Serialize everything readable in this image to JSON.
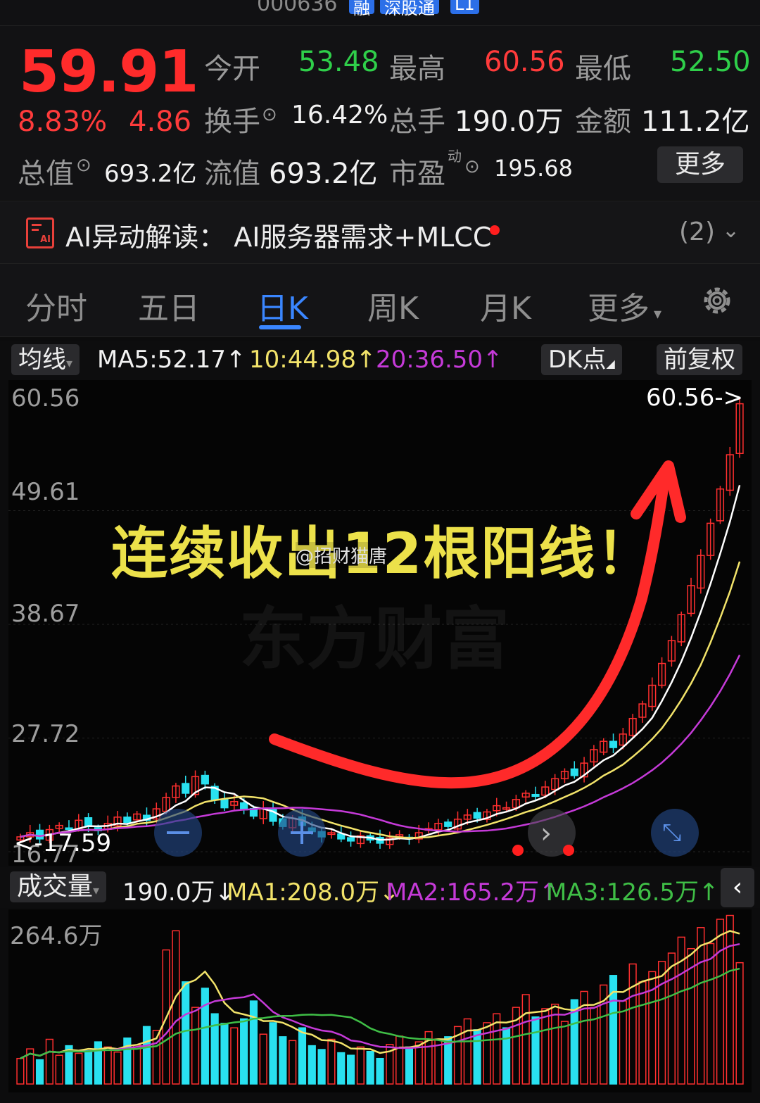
{
  "header": {
    "stock_code": "000636",
    "tags": [
      "融",
      "深股通",
      "L1"
    ]
  },
  "quote": {
    "price": "59.91",
    "change_pct": "8.83%",
    "change": "4.86",
    "open_label": "今开",
    "open": "53.48",
    "high_label": "最高",
    "high": "60.56",
    "low_label": "最低",
    "low": "52.50",
    "turnover_label": "换手",
    "turnover": "16.42%",
    "volume_label": "总手",
    "volume": "190.0万",
    "amount_label": "金额",
    "amount": "111.2亿",
    "mktcap_label": "总值",
    "mktcap": "693.2亿",
    "float_label": "流值",
    "float": "693.2亿",
    "pe_label": "市盈",
    "pe_sup": "动",
    "pe": "195.68",
    "more_label": "更多"
  },
  "ai_bar": {
    "text": "AI异动解读：  AI服务器需求+MLCC",
    "count": "(2)"
  },
  "tabs": [
    "分时",
    "五日",
    "日K",
    "周K",
    "月K",
    "更多"
  ],
  "active_tab": "日K",
  "ma_row": {
    "selector": "均线",
    "ma5": "MA5:52.17↑",
    "ma10": "10:44.98↑",
    "ma20": "20:36.50↑",
    "dk": "DK点",
    "fq": "前复权"
  },
  "chart_data": {
    "type": "candlestick",
    "y_ticks": [
      "60.56",
      "49.61",
      "38.67",
      "27.72",
      "16.77"
    ],
    "ylim": [
      16.77,
      60.56
    ],
    "high_marker": "60.56->",
    "low_marker": "<-17.59",
    "closes": [
      18.2,
      18.6,
      18.0,
      18.9,
      19.3,
      19.0,
      19.8,
      19.2,
      18.8,
      19.5,
      20.1,
      19.6,
      20.4,
      19.8,
      20.9,
      22.0,
      23.1,
      22.4,
      24.0,
      23.3,
      21.8,
      21.0,
      21.6,
      20.8,
      20.2,
      20.9,
      19.7,
      19.2,
      20.0,
      19.3,
      18.7,
      18.2,
      18.6,
      18.0,
      17.8,
      18.3,
      17.9,
      17.59,
      18.1,
      18.4,
      18.0,
      18.6,
      19.0,
      19.5,
      19.2,
      19.9,
      20.3,
      20.0,
      20.6,
      21.2,
      21.0,
      21.8,
      22.4,
      22.1,
      23.0,
      23.8,
      24.5,
      24.1,
      25.3,
      26.6,
      27.4,
      26.8,
      28.1,
      29.6,
      31.0,
      32.8,
      34.9,
      37.1,
      39.6,
      42.4,
      45.3,
      48.4,
      51.7,
      55.0,
      59.91
    ],
    "ma5_label": "MA5",
    "ma10_label": "MA10",
    "ma20_label": "MA20",
    "annotation": "连续收出12根阳线！",
    "watermark": "东方财富",
    "credit": "@招财猫唐"
  },
  "volume": {
    "label": "成交量",
    "value": "190.0万↓",
    "ma1": "MA1:208.0万↓",
    "ma2": "MA2:165.2万↑",
    "ma3": "MA3:126.5万↑",
    "y_tick": "264.6万",
    "values": [
      40,
      55,
      38,
      70,
      45,
      60,
      48,
      52,
      66,
      58,
      50,
      72,
      61,
      90,
      84,
      210,
      240,
      160,
      120,
      150,
      110,
      95,
      88,
      102,
      130,
      78,
      96,
      74,
      68,
      88,
      60,
      54,
      70,
      49,
      45,
      58,
      51,
      40,
      62,
      75,
      58,
      66,
      82,
      70,
      74,
      90,
      102,
      85,
      96,
      110,
      88,
      120,
      140,
      105,
      118,
      125,
      98,
      132,
      145,
      120,
      155,
      170,
      130,
      188,
      160,
      176,
      192,
      205,
      230,
      212,
      245,
      220,
      258,
      264,
      190
    ]
  },
  "colors": {
    "up": "#ff2f2f",
    "down": "#29e1f0",
    "ma5": "#ffffff",
    "ma10": "#f2e36a",
    "ma20": "#c53ad8",
    "ma3": "#3fbe46",
    "accent": "#3a86ff"
  }
}
